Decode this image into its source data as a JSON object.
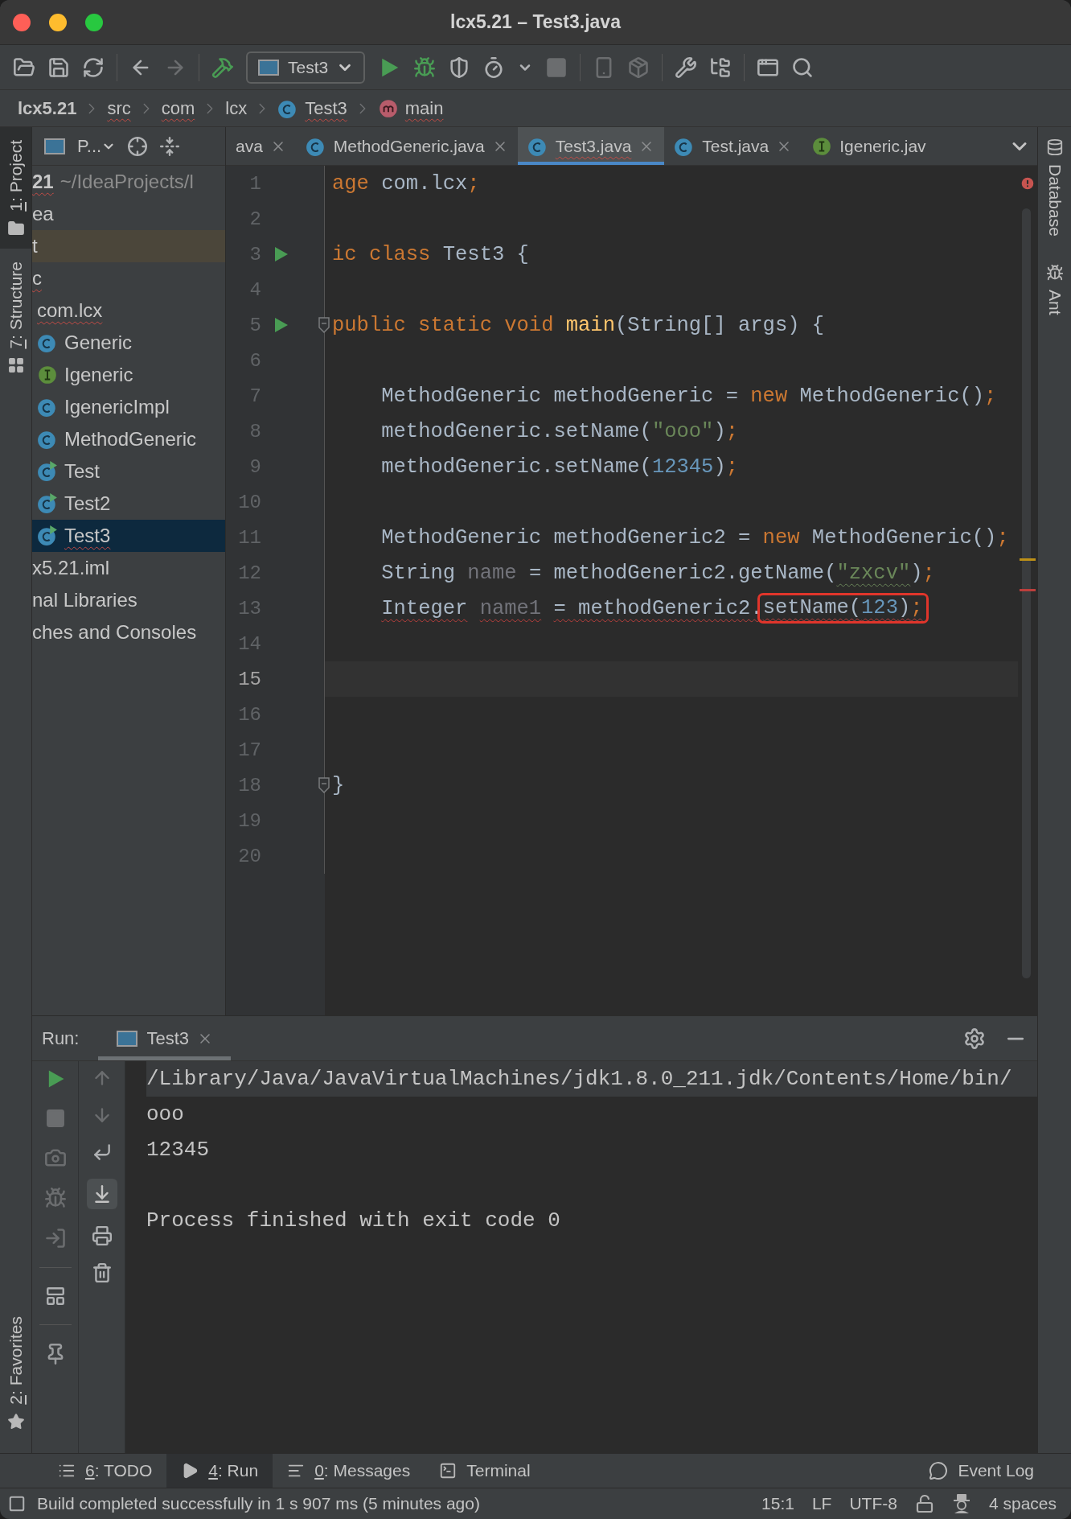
{
  "window": {
    "title": "lcx5.21 – Test3.java"
  },
  "toolbar": {
    "run_config": "Test3"
  },
  "breadcrumbs": [
    {
      "label": "lcx5.21",
      "kind": "project",
      "typo": false
    },
    {
      "label": "src",
      "typo": true
    },
    {
      "label": "com",
      "typo": true
    },
    {
      "label": "lcx",
      "typo": false
    },
    {
      "label": "Test3",
      "kind": "class",
      "typo": true
    },
    {
      "label": "main",
      "kind": "method",
      "typo": true
    }
  ],
  "left_stripe": {
    "top": [
      {
        "key": "1",
        "label": ": Project",
        "selected": true
      },
      {
        "key": "7",
        "label": ": Structure",
        "selected": false
      }
    ],
    "bottom": [
      {
        "key": "2",
        "label": ": Favorites",
        "selected": false
      }
    ]
  },
  "right_stripe": [
    "Database",
    "Ant"
  ],
  "project_panel": {
    "title": "P...",
    "tree": [
      {
        "label": "21",
        "path": "~/IdeaProjects/l",
        "typo": true,
        "selected": false,
        "highlighted": false,
        "children": [
          {
            "label": "ea",
            "typo": false,
            "selected": false,
            "highlighted": false
          },
          {
            "label": "t",
            "typo": false,
            "selected": false,
            "highlighted": true
          },
          {
            "label": "c",
            "typo": true,
            "selected": false,
            "highlighted": false,
            "children": [
              {
                "label": "com.lcx",
                "typo": true,
                "selected": false,
                "highlighted": false,
                "children": [
                  {
                    "label": "Generic",
                    "kind": "class",
                    "typo": false,
                    "selected": false,
                    "highlighted": false
                  },
                  {
                    "label": "Igeneric",
                    "kind": "interface",
                    "typo": false,
                    "selected": false,
                    "highlighted": false
                  },
                  {
                    "label": "IgenericImpl",
                    "kind": "class",
                    "typo": false,
                    "selected": false,
                    "highlighted": false
                  },
                  {
                    "label": "MethodGeneric",
                    "kind": "class",
                    "typo": false,
                    "selected": false,
                    "highlighted": false
                  },
                  {
                    "label": "Test",
                    "kind": "runnable",
                    "typo": false,
                    "selected": false,
                    "highlighted": false
                  },
                  {
                    "label": "Test2",
                    "kind": "runnable",
                    "typo": false,
                    "selected": false,
                    "highlighted": false
                  },
                  {
                    "label": "Test3",
                    "kind": "runnable",
                    "typo": true,
                    "selected": true,
                    "highlighted": false
                  }
                ]
              }
            ]
          },
          {
            "label": "x5.21.iml",
            "typo": false,
            "selected": false,
            "highlighted": false
          }
        ]
      },
      {
        "label": "nal Libraries",
        "typo": false,
        "selected": false,
        "highlighted": false
      },
      {
        "label": "ches and Consoles",
        "typo": false,
        "selected": false,
        "highlighted": false
      }
    ]
  },
  "editor": {
    "tabs": [
      {
        "label": "ava",
        "selected": false,
        "typo": false,
        "closable": true
      },
      {
        "label": "MethodGeneric.java",
        "kind": "class",
        "selected": false,
        "typo": false,
        "closable": true
      },
      {
        "label": "Test3.java",
        "kind": "class",
        "selected": true,
        "typo": true,
        "closable": true
      },
      {
        "label": "Test.java",
        "kind": "class",
        "selected": false,
        "typo": false,
        "closable": true
      },
      {
        "label": "Igeneric.jav",
        "kind": "interface",
        "selected": false,
        "typo": false,
        "closable": false
      }
    ],
    "lines": [
      {
        "n": "1",
        "run": false,
        "fold": false,
        "current": false,
        "error": false,
        "tokens": [
          {
            "t": "age",
            "kind": "keyword"
          },
          {
            "t": " com.lcx"
          },
          {
            "t": ";",
            "kind": "keyword"
          }
        ]
      },
      {
        "n": "2",
        "run": false,
        "fold": false,
        "current": false
      },
      {
        "n": "3",
        "run": true,
        "fold": false,
        "current": false,
        "error": false,
        "tokens": [
          {
            "t": "ic class",
            "kind": "keyword"
          },
          {
            "t": " Test3 {"
          }
        ]
      },
      {
        "n": "4",
        "run": false,
        "fold": false,
        "current": false
      },
      {
        "n": "5",
        "run": true,
        "fold": true,
        "current": false,
        "error": false,
        "tokens": [
          {
            "t": "public static void",
            "kind": "keyword"
          },
          {
            "t": " main",
            "kind": "method"
          },
          {
            "t": "(String[] args) {"
          }
        ]
      },
      {
        "n": "6",
        "run": false,
        "fold": false,
        "current": false
      },
      {
        "n": "7",
        "run": false,
        "fold": false,
        "current": false,
        "error": false,
        "tokens": [
          {
            "t": "    MethodGeneric methodGeneric = "
          },
          {
            "t": "new",
            "kind": "keyword"
          },
          {
            "t": " MethodGeneric()"
          },
          {
            "t": ";",
            "kind": "keyword"
          }
        ]
      },
      {
        "n": "8",
        "run": false,
        "fold": false,
        "current": false,
        "error": false,
        "tokens": [
          {
            "t": "    methodGeneric.setName("
          },
          {
            "t": "\"ooo\"",
            "kind": "string"
          },
          {
            "t": ")"
          },
          {
            "t": ";",
            "kind": "keyword"
          }
        ]
      },
      {
        "n": "9",
        "run": false,
        "fold": false,
        "current": false,
        "error": false,
        "tokens": [
          {
            "t": "    methodGeneric.setName("
          },
          {
            "t": "12345",
            "kind": "number"
          },
          {
            "t": ")"
          },
          {
            "t": ";",
            "kind": "keyword"
          }
        ]
      },
      {
        "n": "10",
        "run": false,
        "fold": false,
        "current": false
      },
      {
        "n": "11",
        "run": false,
        "fold": false,
        "current": false,
        "error": false,
        "tokens": [
          {
            "t": "    MethodGeneric methodGeneric2 = "
          },
          {
            "t": "new",
            "kind": "keyword"
          },
          {
            "t": " MethodGeneric()"
          },
          {
            "t": ";",
            "kind": "keyword"
          }
        ]
      },
      {
        "n": "12",
        "run": false,
        "fold": false,
        "current": false,
        "error": false,
        "tokens": [
          {
            "t": "    String"
          },
          {
            "t": " name",
            "kind": "unused"
          },
          {
            "t": " = methodGeneric2.getName("
          },
          {
            "t": "\"zxcv\"",
            "kind": "misspelled"
          },
          {
            "t": ")"
          },
          {
            "t": ";",
            "kind": "keyword"
          }
        ]
      },
      {
        "n": "13",
        "run": false,
        "fold": false,
        "current": false,
        "error": true,
        "tokens": [
          {
            "t": "    Integer"
          },
          {
            "t": " name1",
            "kind": "unused"
          },
          {
            "t": " = methodGeneric2."
          }
        ],
        "boxed_tokens": [
          {
            "t": "setName("
          },
          {
            "t": "123",
            "kind": "number"
          },
          {
            "t": ")"
          },
          {
            "t": ";",
            "kind": "keyword"
          }
        ]
      },
      {
        "n": "14",
        "run": false,
        "fold": false,
        "current": false
      },
      {
        "n": "15",
        "run": false,
        "fold": false,
        "current": true
      },
      {
        "n": "16",
        "run": false,
        "fold": false,
        "current": false
      },
      {
        "n": "17",
        "run": false,
        "fold": false,
        "current": false
      },
      {
        "n": "18",
        "run": false,
        "fold": true,
        "current": false,
        "error": false,
        "tokens": [
          {
            "t": "}"
          }
        ]
      },
      {
        "n": "19",
        "run": false,
        "fold": false,
        "current": false
      },
      {
        "n": "20",
        "run": false,
        "fold": false,
        "current": false
      }
    ]
  },
  "run_panel": {
    "label": "Run:",
    "tab": {
      "label": "Test3",
      "selected": true
    },
    "console": [
      {
        "kind": "command",
        "text": "/Library/Java/JavaVirtualMachines/jdk1.8.0_211.jdk/Contents/Home/bin/"
      },
      {
        "kind": "output",
        "text": "ooo"
      },
      {
        "kind": "output",
        "text": "12345"
      },
      {
        "kind": "blank"
      },
      {
        "kind": "output",
        "text": "Process finished with exit code 0"
      }
    ]
  },
  "tool_windows": [
    {
      "key": "6",
      "label": ": TODO",
      "selected": false
    },
    {
      "key": "4",
      "label": ": Run",
      "selected": true
    },
    {
      "key": "0",
      "label": ": Messages",
      "selected": false
    },
    {
      "label": "Terminal",
      "selected": false
    }
  ],
  "event_log": "Event Log",
  "status_bar": {
    "message": "Build completed successfully in 1 s 907 ms (5 minutes ago)",
    "position": "15:1",
    "line_separator": "LF",
    "encoding": "UTF-8",
    "indent": "4 spaces"
  }
}
